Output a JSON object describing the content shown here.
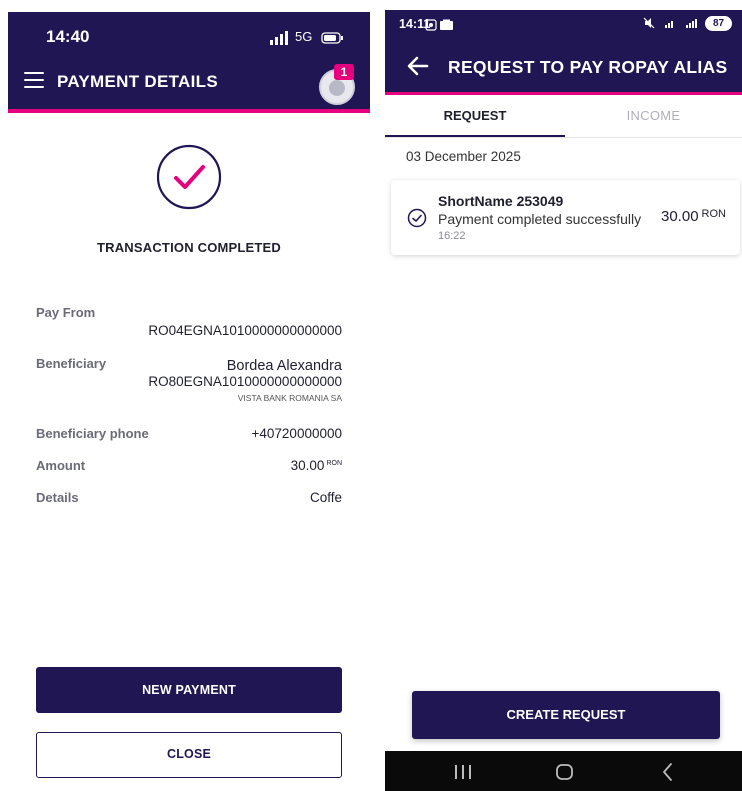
{
  "left_screen": {
    "status_bar": {
      "time": "14:40",
      "network": "5G"
    },
    "header": {
      "title": "PAYMENT DETAILS",
      "notification_count": "1"
    },
    "status_text": "TRANSACTION COMPLETED",
    "fields": {
      "pay_from": {
        "label": "Pay From",
        "value": "RO04EGNA1010000000000000"
      },
      "beneficiary": {
        "label": "Beneficiary",
        "name": "Bordea Alexandra",
        "iban": "RO80EGNA1010000000000000",
        "bank": "VISTA BANK ROMANIA SA"
      },
      "beneficiary_phone": {
        "label": "Beneficiary phone",
        "value": "+40720000000"
      },
      "amount": {
        "label": "Amount",
        "value": "30.00",
        "currency": "RON"
      },
      "details": {
        "label": "Details",
        "value": "Coffe"
      }
    },
    "buttons": {
      "new_payment": "NEW PAYMENT",
      "close": "CLOSE"
    }
  },
  "right_screen": {
    "status_bar": {
      "time": "14:11",
      "battery": "87"
    },
    "header": {
      "title": "REQUEST TO PAY ROPAY ALIAS"
    },
    "tabs": [
      {
        "label": "REQUEST",
        "active": true
      },
      {
        "label": "INCOME",
        "active": false
      }
    ],
    "date": "03 December 2025",
    "transaction": {
      "name": "ShortName 253049",
      "description": "Payment completed successfully",
      "time": "16:22",
      "amount": "30.00",
      "currency": "RON"
    },
    "buttons": {
      "create_request": "CREATE REQUEST"
    }
  },
  "colors": {
    "brand": "#1f1653",
    "accent": "#e6007e"
  }
}
